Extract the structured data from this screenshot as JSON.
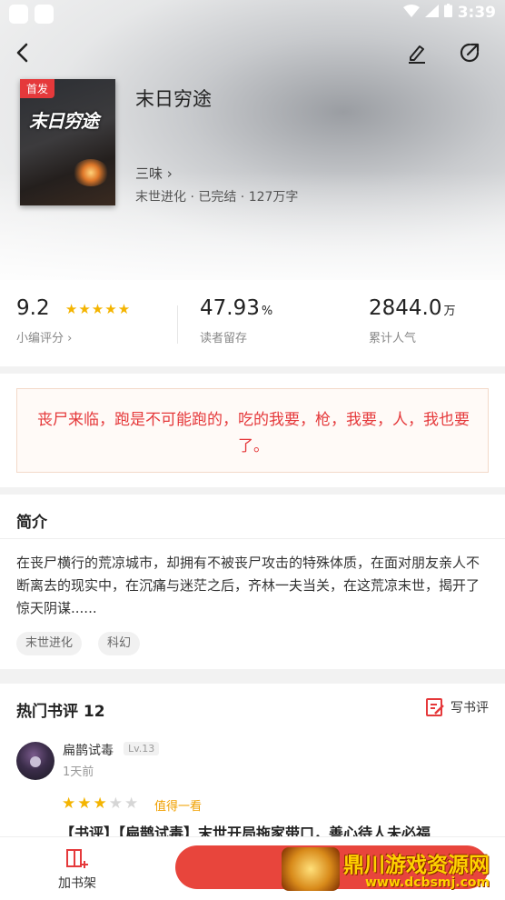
{
  "status_bar": {
    "time": "3:39"
  },
  "book": {
    "title": "末日穷途",
    "badge": "首发",
    "cover_title": "末日穷途",
    "author": "三味 ›",
    "meta": "末世进化 · 已完结 · 127万字"
  },
  "stats": {
    "score": "9.2",
    "score_label": "小编评分 ›",
    "stars_filled": 5,
    "retention": "47.93",
    "retention_unit": "%",
    "retention_label": "读者留存",
    "popularity": "2844.0",
    "popularity_unit": "万",
    "popularity_label": "累计人气"
  },
  "quote": {
    "text": "丧尸来临，跑是不可能跑的，吃的我要，枪，我要，人，我也要了。"
  },
  "intro": {
    "title": "简介",
    "text": "在丧尸横行的荒凉城市，却拥有不被丧尸攻击的特殊体质，在面对朋友亲人不断离去的现实中，在沉痛与迷茫之后，齐林一夫当关，在这荒凉末世，揭开了惊天阴谋......",
    "tags": [
      "末世进化",
      "科幻"
    ]
  },
  "reviews": {
    "title": "热门书评 12",
    "write_label": "写书评",
    "items": [
      {
        "user": "扁鹊试毒",
        "level": "Lv.13",
        "time": "1天前",
        "rating": 3,
        "rating_label": "值得一看",
        "title": "【书评】【扁鹊试毒】末世开局拖家带口，善心待人未必福"
      }
    ]
  },
  "bottom": {
    "shelf_label": "加书架"
  },
  "watermark": {
    "main": "鼎川游戏资源网",
    "sub": "www.dcbsmj.com"
  },
  "colors": {
    "accent": "#e5393b",
    "star": "#f4b400",
    "star_empty": "#d6d6d6",
    "button": "#e8453c"
  }
}
